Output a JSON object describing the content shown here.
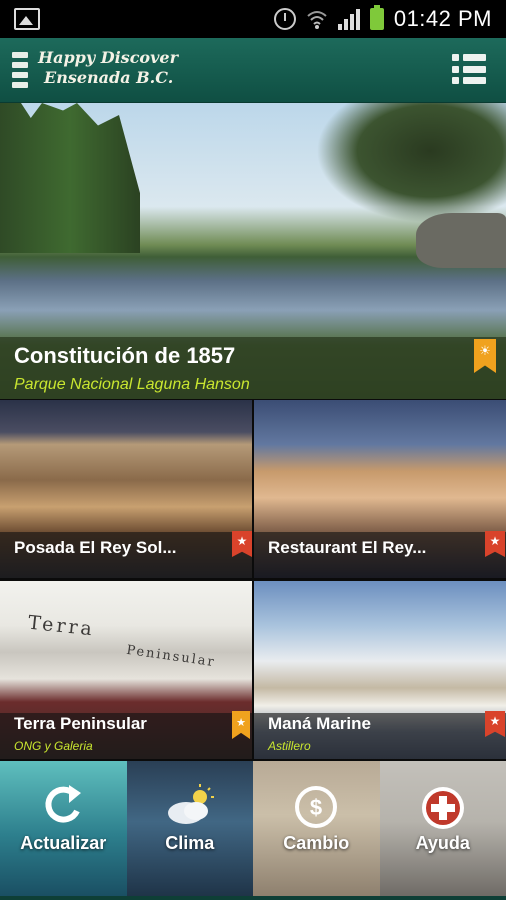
{
  "status_bar": {
    "time": "01:42 PM",
    "icons": [
      "gallery-icon",
      "alarm-icon",
      "wifi-icon",
      "signal-icon",
      "battery-icon"
    ]
  },
  "app_bar": {
    "title_line1": "Happy Discover",
    "title_line2": "Ensenada B.C.",
    "menu_icon": "menu-icon",
    "list_icon": "list-view-icon",
    "color": "#1a5f52"
  },
  "featured": {
    "title": "Constitución de 1857",
    "subtitle": "Parque Nacional  Laguna Hanson",
    "badge_icon": "sun-bookmark-icon",
    "badge_color": "#f0a21e"
  },
  "cards": [
    {
      "title": "Posada El Rey Sol...",
      "subtitle": "",
      "badge_icon": "star-icon",
      "badge_color": "#d9432b"
    },
    {
      "title": "Restaurant El Rey...",
      "subtitle": "",
      "badge_icon": "star-icon",
      "badge_color": "#d9432b"
    },
    {
      "title": "Terra Peninsular",
      "subtitle": "ONG y Galeria",
      "badge_icon": "star-bookmark-icon",
      "badge_color": "#f0a21e",
      "photo_sign_line1": "Terra",
      "photo_sign_line2": "Peninsular"
    },
    {
      "title": "Maná Marine",
      "subtitle": "Astillero",
      "badge_icon": "star-icon",
      "badge_color": "#d9432b"
    }
  ],
  "tiles": [
    {
      "label": "Actualizar",
      "icon": "refresh-icon"
    },
    {
      "label": "Clima",
      "icon": "weather-icon"
    },
    {
      "label": "Cambio",
      "icon": "currency-exchange-icon"
    },
    {
      "label": "Ayuda",
      "icon": "medical-help-icon"
    }
  ]
}
